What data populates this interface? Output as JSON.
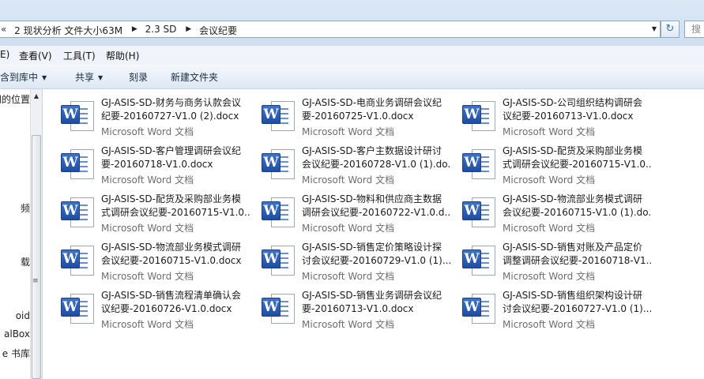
{
  "address": {
    "overflow": "«",
    "crumbs": [
      "2 现状分析 文件大小63M",
      "2.3 SD",
      "会议纪要"
    ],
    "search_placeholder": "搜"
  },
  "menu": [
    "E)",
    "查看(V)",
    "工具(T)",
    "帮助(H)"
  ],
  "toolbar": {
    "include_library": "包含到库中",
    "share": "共享",
    "burn": "刻录",
    "new_folder": "新建文件夹"
  },
  "nav": {
    "items": [
      "问的位置",
      "频",
      "载",
      "oid",
      "alBox",
      "e 书库"
    ]
  },
  "files": [
    {
      "line1": "GJ-ASIS-SD-财务与商务认款会议",
      "line2": "纪要-20160727-V1.0 (2).docx",
      "type": "Microsoft Word 文档"
    },
    {
      "line1": "GJ-ASIS-SD-电商业务调研会议纪",
      "line2": "要-20160725-V1.0.docx",
      "type": "Microsoft Word 文档"
    },
    {
      "line1": "GJ-ASIS-SD-公司组织结构调研会",
      "line2": "议纪要-20160713-V1.0.docx",
      "type": "Microsoft Word 文档"
    },
    {
      "line1": "GJ-ASIS-SD-客户管理调研会议纪",
      "line2": "要-20160718-V1.0.docx",
      "type": "Microsoft Word 文档"
    },
    {
      "line1": "GJ-ASIS-SD-客户主数据设计研讨",
      "line2": "会议纪要-20160728-V1.0 (1).do...",
      "type": "Microsoft Word 文档"
    },
    {
      "line1": "GJ-ASIS-SD-配货及采购部业务模",
      "line2": "式调研会议纪要-20160715-V1.0...",
      "type": "Microsoft Word 文档"
    },
    {
      "line1": "GJ-ASIS-SD-配货及采购部业务模",
      "line2": "式调研会议纪要-20160715-V1.0....",
      "type": "Microsoft Word 文档"
    },
    {
      "line1": "GJ-ASIS-SD-物料和供应商主数据",
      "line2": "调研会议纪要-20160722-V1.0.d...",
      "type": "Microsoft Word 文档"
    },
    {
      "line1": "GJ-ASIS-SD-物流部业务模式调研",
      "line2": "会议纪要-20160715-V1.0 (1).do...",
      "type": "Microsoft Word 文档"
    },
    {
      "line1": "GJ-ASIS-SD-物流部业务模式调研",
      "line2": "会议纪要-20160715-V1.0.docx",
      "type": "Microsoft Word 文档"
    },
    {
      "line1": "GJ-ASIS-SD-销售定价策略设计探",
      "line2": "讨会议纪要-20160729-V1.0 (1)....",
      "type": "Microsoft Word 文档"
    },
    {
      "line1": "GJ-ASIS-SD-销售对账及产品定价",
      "line2": "调整调研会议纪要-20160718-V1...",
      "type": "Microsoft Word 文档"
    },
    {
      "line1": "GJ-ASIS-SD-销售流程清单确认会",
      "line2": "议纪要-20160726-V1.0.docx",
      "type": "Microsoft Word 文档"
    },
    {
      "line1": "GJ-ASIS-SD-销售业务调研会议纪",
      "line2": "要-20160713-V1.0.docx",
      "type": "Microsoft Word 文档"
    },
    {
      "line1": "GJ-ASIS-SD-销售组织架构设计研",
      "line2": "讨会议纪要-20160727-V1.0 (1)....",
      "type": "Microsoft Word 文档"
    }
  ]
}
